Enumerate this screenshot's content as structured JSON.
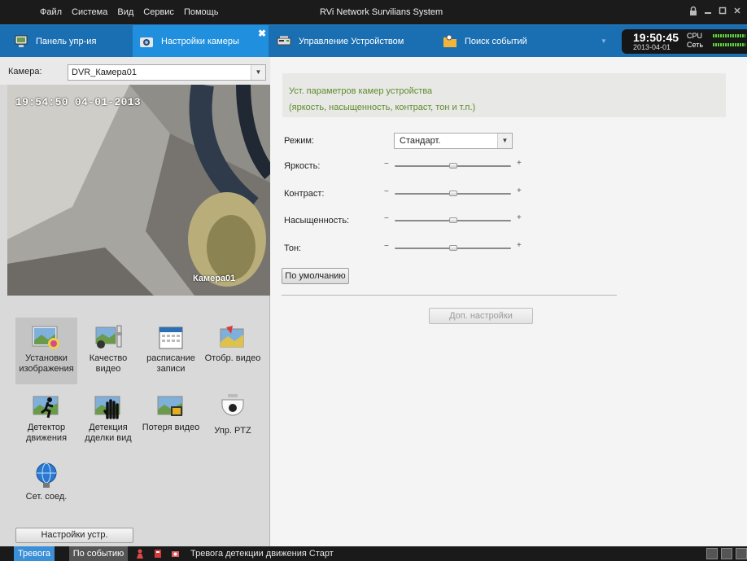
{
  "menubar": {
    "items": [
      "Файл",
      "Система",
      "Вид",
      "Сервис",
      "Помощь"
    ],
    "title": "RVi Network Survilians System"
  },
  "tabs": [
    {
      "label": "Панель упр-ия"
    },
    {
      "label": "Настройки камеры"
    },
    {
      "label": "Управление Устройством"
    },
    {
      "label": "Поиск событий"
    }
  ],
  "clock": {
    "time": "19:50:45",
    "date": "2013-04-01",
    "cpu_label": "CPU",
    "net_label": "Сеть"
  },
  "camera": {
    "label": "Камера:",
    "selected": "DVR_Камера01"
  },
  "video": {
    "osd_time": "19:54:50 04-01-2013",
    "osd_name": "Камера01"
  },
  "left_icons": [
    {
      "label": "Установки изображения"
    },
    {
      "label": "Качество видео"
    },
    {
      "label": "расписание записи"
    },
    {
      "label": "Отобр. видео"
    },
    {
      "label": "Детектор движения"
    },
    {
      "label": "Детекция дделки вид"
    },
    {
      "label": "Потеря видео"
    },
    {
      "label": "Упр. PTZ"
    },
    {
      "label": "Сет. соед."
    }
  ],
  "device_settings_button": "Настройки устр.",
  "info": {
    "line1": "Уст. параметров камер устройства",
    "line2": "(яркость, насыщенность, контраст, тон и т.п.)"
  },
  "settings": {
    "mode_label": "Режим:",
    "mode_value": "Стандарт.",
    "minus": "−",
    "plus": "+",
    "sliders": [
      {
        "label": "Яркость:",
        "level": 0.5
      },
      {
        "label": "Контраст:",
        "level": 0.5
      },
      {
        "label": "Насыщенность:",
        "level": 0.5
      },
      {
        "label": "Тон:",
        "level": 0.5
      }
    ],
    "default_button": "По умолчанию",
    "advanced_button": "Доп. настройки"
  },
  "statusbar": {
    "alarm_tab": "Тревога",
    "event_tab": "По событию",
    "message": "Тревога детекции движения Старт"
  }
}
